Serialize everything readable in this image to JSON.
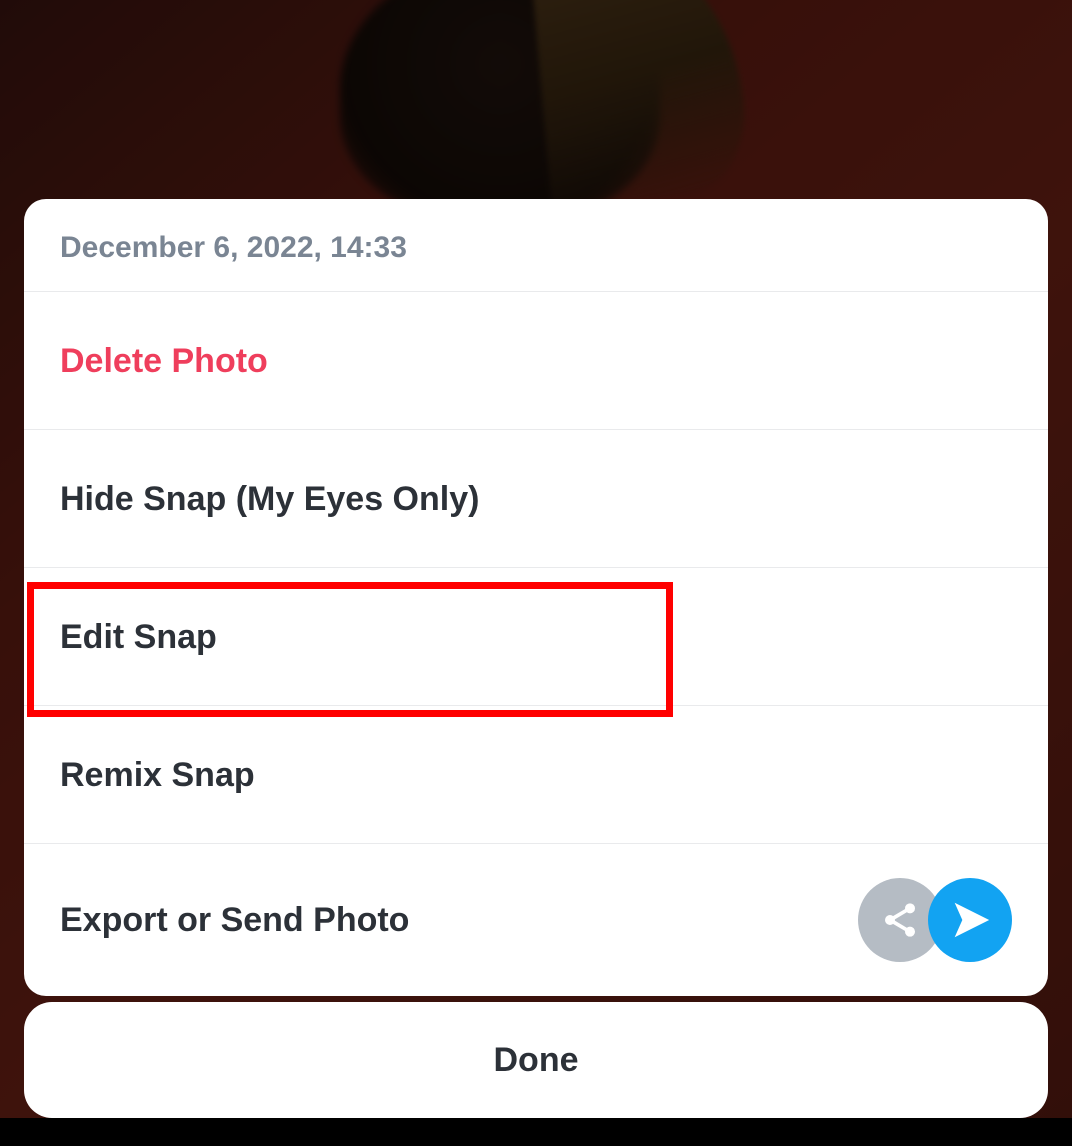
{
  "sheet": {
    "timestamp": "December 6, 2022, 14:33",
    "items": [
      {
        "label": "Delete Photo",
        "danger": true
      },
      {
        "label": "Hide Snap (My Eyes Only)"
      },
      {
        "label": "Edit Snap"
      },
      {
        "label": "Remix Snap"
      },
      {
        "label": "Export or Send Photo",
        "has_icons": true
      }
    ]
  },
  "done_label": "Done"
}
